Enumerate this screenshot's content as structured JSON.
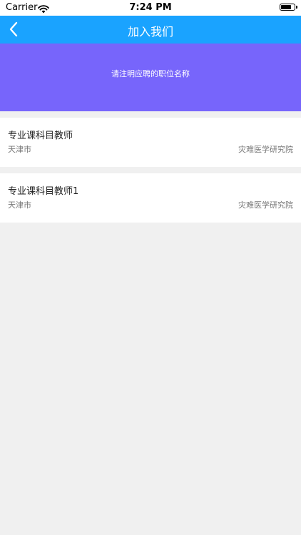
{
  "status_bar": {
    "carrier": "Carrier",
    "time": "7:24 PM",
    "battery_level": 0.8,
    "icons": [
      "wifi-icon",
      "battery-icon"
    ]
  },
  "nav": {
    "title": "加入我们",
    "back_icon": "chevron-left-icon",
    "background_color": "#1aa3ff"
  },
  "banner": {
    "text": "请注明应聘的职位名称",
    "background_color": "#7765fb"
  },
  "jobs": [
    {
      "title": "专业课科目教师",
      "city": "天津市",
      "organization": "灾难医学研究院"
    },
    {
      "title": "专业课科目教师1",
      "city": "天津市",
      "organization": "灾难医学研究院"
    }
  ]
}
